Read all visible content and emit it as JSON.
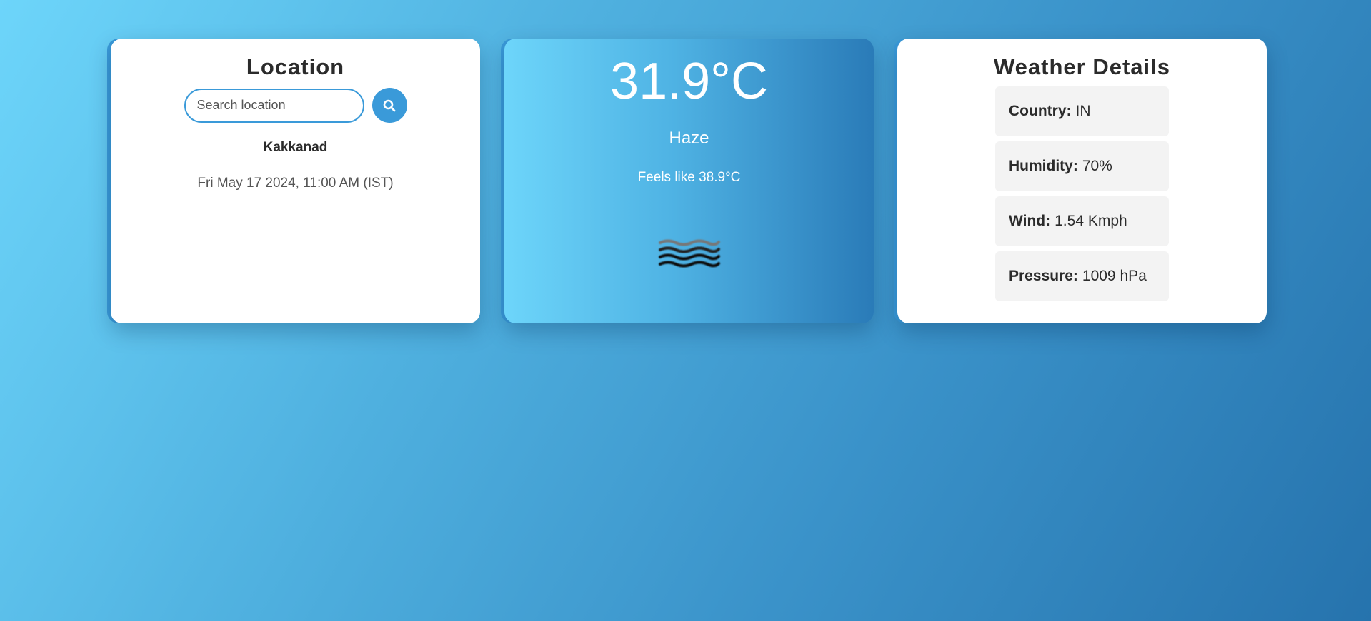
{
  "location_card": {
    "title": "Location",
    "search_placeholder": "Search location",
    "search_icon": "search-icon",
    "city": "Kakkanad",
    "datetime": "Fri May 17 2024, 11:00 AM (IST)"
  },
  "current_card": {
    "temperature": "31.9°C",
    "condition": "Haze",
    "feels_like": "Feels like 38.9°C",
    "icon": "haze-icon"
  },
  "details_card": {
    "title": "Weather Details",
    "items": [
      {
        "label": "Country:",
        "value": "IN"
      },
      {
        "label": "Humidity:",
        "value": "70%"
      },
      {
        "label": "Wind:",
        "value": "1.54 Kmph"
      },
      {
        "label": "Pressure:",
        "value": "1009 hPa"
      }
    ]
  },
  "colors": {
    "accent": "#3a9ad9",
    "background_start": "#6dd5fa",
    "background_end": "#2673ad"
  }
}
